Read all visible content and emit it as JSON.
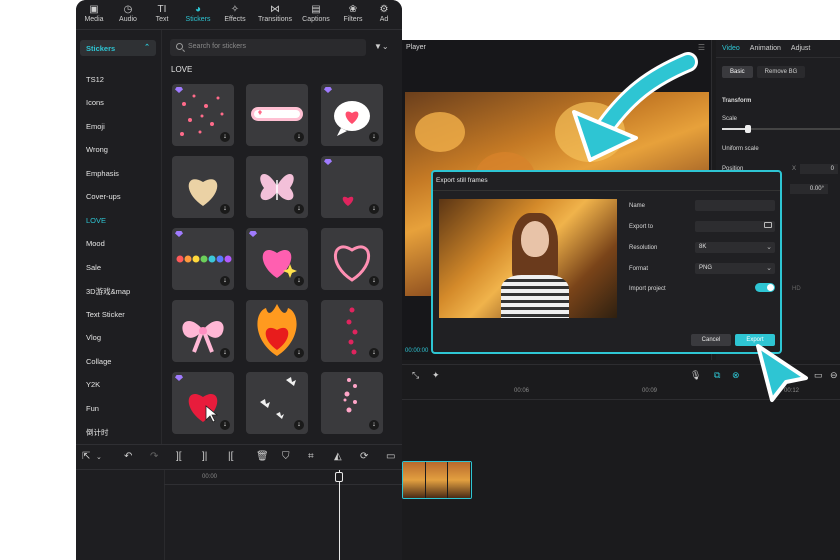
{
  "stickers_panel": {
    "tabs": [
      {
        "label": "Media",
        "icon": "media-icon"
      },
      {
        "label": "Audio",
        "icon": "audio-icon"
      },
      {
        "label": "Text",
        "icon": "text-icon"
      },
      {
        "label": "Stickers",
        "icon": "stickers-icon",
        "active": true
      },
      {
        "label": "Effects",
        "icon": "effects-icon"
      },
      {
        "label": "Transitions",
        "icon": "transitions-icon"
      },
      {
        "label": "Captions",
        "icon": "captions-icon"
      },
      {
        "label": "Filters",
        "icon": "filters-icon"
      },
      {
        "label": "Ad",
        "icon": "adjust-icon"
      }
    ],
    "sidebar_header": "Stickers",
    "categories": [
      "TS12",
      "Icons",
      "Emoji",
      "Wrong",
      "Emphasis",
      "Cover-ups",
      "LOVE",
      "Mood",
      "Sale",
      "3D游戏&map",
      "Text Sticker",
      "Vlog",
      "Collage",
      "Y2K",
      "Fun",
      "倒计时"
    ],
    "active_category": "LOVE",
    "search_placeholder": "Search for stickers",
    "section_title": "LOVE",
    "timeline_time": "00:00"
  },
  "editor": {
    "player_title": "Player",
    "player_time": "00:00:00",
    "inspector_tabs": [
      "Video",
      "Animation",
      "Adjust"
    ],
    "inspector_active_tab": "Video",
    "inspector_subtabs": [
      "Basic",
      "Remove BG"
    ],
    "transform_label": "Transform",
    "scale_label": "Scale",
    "scale_value": 0.22,
    "uniform_scale_label": "Uniform scale",
    "position_label": "Position",
    "position_x_label": "X",
    "position_x": "0",
    "rotation_value": "0.00°",
    "hd_label": "HD",
    "ruler_marks": [
      "00:06",
      "00:09",
      "00:12"
    ]
  },
  "dialog": {
    "title": "Export still frames",
    "fields": {
      "name_label": "Name",
      "export_to_label": "Export to",
      "resolution_label": "Resolution",
      "resolution_value": "8K",
      "format_label": "Format",
      "format_value": "PNG",
      "import_project_label": "Import project",
      "import_project_on": true
    },
    "cancel_label": "Cancel",
    "export_label": "Export"
  },
  "colors": {
    "accent": "#2ec5d3",
    "panel": "#1e1e21",
    "tile": "#3a3a3d"
  }
}
